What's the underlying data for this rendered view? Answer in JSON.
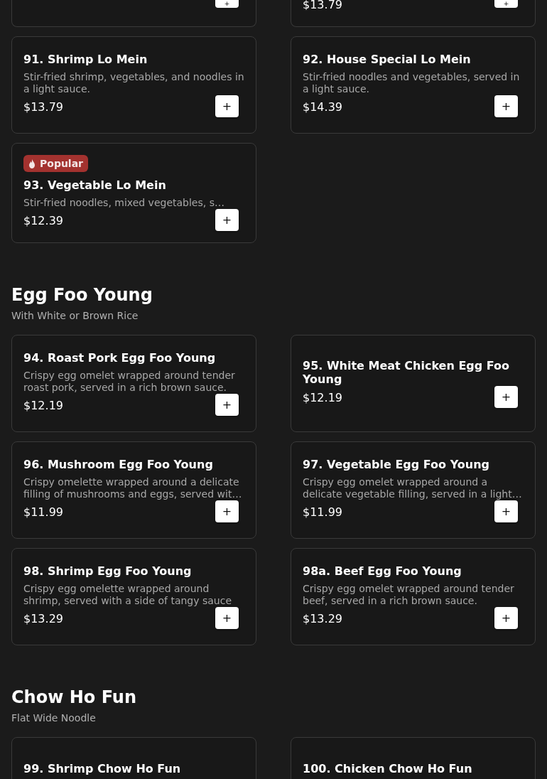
{
  "sections": [
    {
      "items": [
        {
          "kind": "partial",
          "button": "+"
        },
        {
          "kind": "partial",
          "price": "$13.79",
          "button": "+"
        },
        {
          "title": "91. Shrimp Lo Mein",
          "description": "Stir-fried shrimp, vegetables, and noodles in a light sauce.",
          "price": "$13.79",
          "button": "+"
        },
        {
          "title": "92. House Special Lo Mein",
          "description": "Stir-fried noodles and vegetables, served in a light sauce.",
          "price": "$14.39",
          "button": "+"
        },
        {
          "badge": "Popular",
          "title": "93. Vegetable Lo Mein",
          "description": "Stir-fried noodles, mixed vegetables, s…",
          "price": "$12.39",
          "button": "+"
        }
      ]
    },
    {
      "title": "Egg Foo Young",
      "subtitle": "With White or Brown Rice",
      "items": [
        {
          "title": "94. Roast Pork Egg Foo Young",
          "description": "Crispy egg omelet wrapped around tender roast pork, served in a rich brown sauce.",
          "price": "$12.19",
          "button": "+"
        },
        {
          "title": "95. White Meat Chicken Egg Foo Young",
          "price": "$12.19",
          "button": "+"
        },
        {
          "title": "96. Mushroom Egg Foo Young",
          "description": "Crispy omelette wrapped around a delicate filling of mushrooms and eggs, served wit…",
          "price": "$11.99",
          "button": "+"
        },
        {
          "title": "97. Vegetable Egg Foo Young",
          "description": "Crispy egg omelet wrapped around a delicate vegetable filling, served in a light…",
          "price": "$11.99",
          "button": "+"
        },
        {
          "title": "98. Shrimp Egg Foo Young",
          "description": "Crispy egg omelette wrapped around shrimp, served with a side of tangy sauce",
          "price": "$13.29",
          "button": "+"
        },
        {
          "title": "98a. Beef Egg Foo Young",
          "description": "Crispy egg omelet wrapped around tender beef, served in a rich brown sauce.",
          "price": "$13.29",
          "button": "+"
        }
      ]
    },
    {
      "title": "Chow Ho Fun",
      "subtitle": "Flat Wide Noodle",
      "items": [
        {
          "title": "99. Shrimp Chow Ho Fun"
        },
        {
          "title": "100. Chicken Chow Ho Fun"
        }
      ]
    }
  ]
}
